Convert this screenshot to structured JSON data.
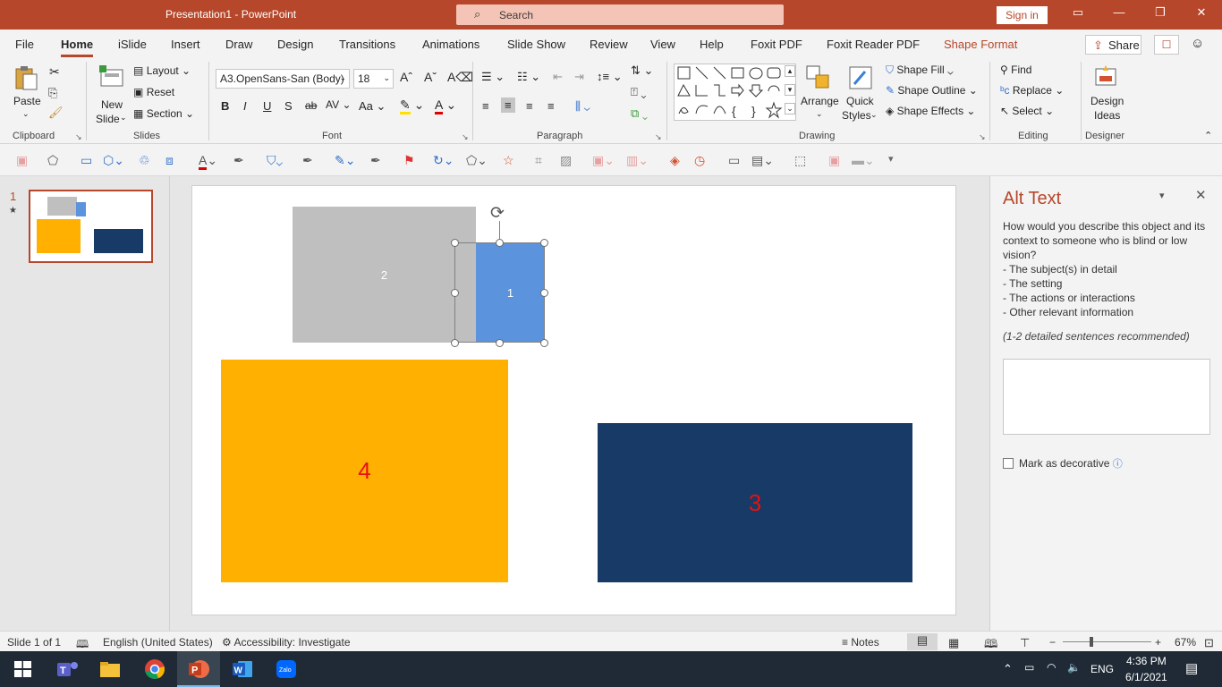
{
  "window": {
    "title": "Presentation1  -  PowerPoint",
    "search_placeholder": "Search",
    "signin": "Sign in"
  },
  "tabs": [
    "File",
    "Home",
    "iSlide",
    "Insert",
    "Draw",
    "Design",
    "Transitions",
    "Animations",
    "Slide Show",
    "Review",
    "View",
    "Help",
    "Foxit PDF",
    "Foxit Reader PDF",
    "Shape Format"
  ],
  "share": "Share",
  "ribbon": {
    "clipboard": {
      "label": "Clipboard",
      "paste": "Paste"
    },
    "slides": {
      "label": "Slides",
      "new_slide": "New",
      "new_slide2": "Slide",
      "layout": "Layout",
      "reset": "Reset",
      "section": "Section"
    },
    "font": {
      "label": "Font",
      "name": "A3.OpenSans-San (Body)",
      "size": "18",
      "bold": "B",
      "italic": "I",
      "underline": "U",
      "shadow": "S",
      "strike": "ab",
      "spacing": "AV",
      "case": "Aa"
    },
    "paragraph": {
      "label": "Paragraph"
    },
    "drawing": {
      "label": "Drawing",
      "arrange": "Arrange",
      "quick_styles": "Quick",
      "quick_styles2": "Styles",
      "shape_fill": "Shape Fill",
      "shape_outline": "Shape Outline",
      "shape_effects": "Shape Effects"
    },
    "editing": {
      "label": "Editing",
      "find": "Find",
      "replace": "Replace",
      "select": "Select"
    },
    "designer": {
      "label": "Designer",
      "design_ideas": "Design",
      "design_ideas2": "Ideas"
    }
  },
  "thumbnail": {
    "number": "1",
    "star": "★"
  },
  "slide": {
    "shapes": [
      {
        "label": "2",
        "color": "#bfbfbf"
      },
      {
        "label": "1",
        "color": "#5b93dc"
      },
      {
        "label": "4",
        "color": "#ffb000",
        "text_color": "#e81010"
      },
      {
        "label": "3",
        "color": "#173a66",
        "text_color": "#e81010"
      }
    ]
  },
  "alt_text": {
    "title": "Alt Text",
    "description": "How would you describe this object and its context to someone who is blind or low vision?",
    "bullets": [
      "- The subject(s) in detail",
      "- The setting",
      "- The actions or interactions",
      "- Other relevant information"
    ],
    "hint": "(1-2 detailed sentences recommended)",
    "input_value": "",
    "decorative": "Mark as decorative"
  },
  "status": {
    "slide": "Slide 1 of 1",
    "language": "English (United States)",
    "accessibility": "Accessibility: Investigate",
    "notes": "Notes",
    "zoom": "67%"
  },
  "taskbar": {
    "time": "4:36 PM",
    "date": "6/1/2021",
    "lang": "ENG"
  }
}
